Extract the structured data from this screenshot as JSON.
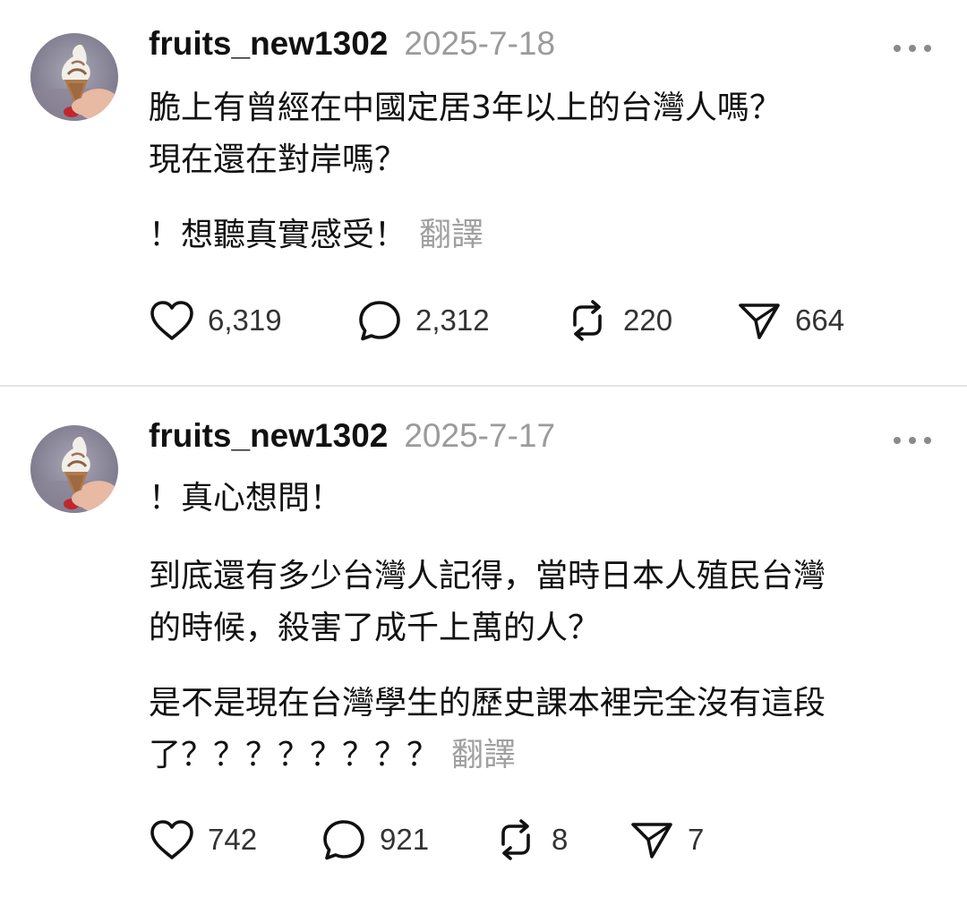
{
  "posts": [
    {
      "username": "fruits_new1302",
      "date": "2025-7-18",
      "paragraphs": [
        "脆上有曾經在中國定居3年以上的台灣人嗎？\n現在還在對岸嗎？",
        "！想聽真實感受！"
      ],
      "translate_label": "翻譯",
      "stats": {
        "likes": "6,319",
        "replies": "2,312",
        "reposts": "220",
        "shares": "664"
      }
    },
    {
      "username": "fruits_new1302",
      "date": "2025-7-17",
      "paragraphs": [
        "！真心想問！",
        "到底還有多少台灣人記得，當時日本人殖民台灣\n的時候，殺害了成千上萬的人？",
        "是不是現在台灣學生的歷史課本裡完全沒有這段\n了？？？？？？？？"
      ],
      "translate_label": "翻譯",
      "stats": {
        "likes": "742",
        "replies": "921",
        "reposts": "8",
        "shares": "7"
      }
    }
  ],
  "icons": {
    "avatar": "soft-serve-ice-cream-cone-photo",
    "more": "more-horizontal-icon",
    "like": "heart-icon",
    "reply": "comment-bubble-icon",
    "repost": "repost-icon",
    "share": "send-icon"
  },
  "colors": {
    "text": "#111111",
    "muted": "#9b9b9b",
    "divider": "#e4e4e4"
  }
}
